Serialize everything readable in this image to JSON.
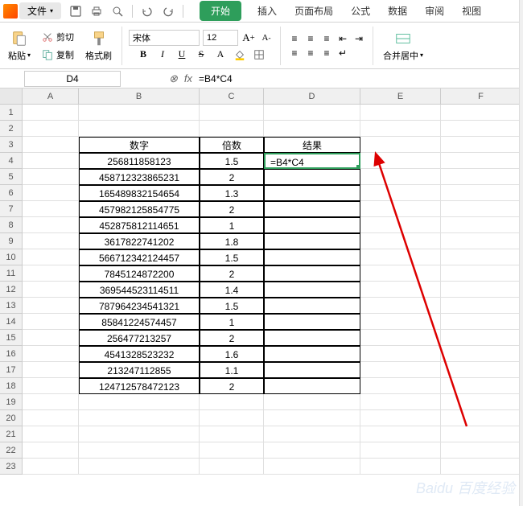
{
  "menubar": {
    "file_label": "文件",
    "tabs": [
      "开始",
      "插入",
      "页面布局",
      "公式",
      "数据",
      "审阅",
      "视图"
    ],
    "active_tab_index": 0
  },
  "ribbon": {
    "paste_label": "粘贴",
    "cut_label": "剪切",
    "copy_label": "复制",
    "format_painter_label": "格式刷",
    "font_name": "宋体",
    "font_size": "12",
    "merge_label": "合并居中"
  },
  "formula_bar": {
    "cell_ref": "D4",
    "formula": "=B4*C4"
  },
  "columns": [
    "A",
    "B",
    "C",
    "D",
    "E",
    "F"
  ],
  "row_numbers": [
    1,
    2,
    3,
    4,
    5,
    6,
    7,
    8,
    9,
    10,
    11,
    12,
    13,
    14,
    15,
    16,
    17,
    18,
    19,
    20,
    21,
    22,
    23
  ],
  "table_header": {
    "b": "数字",
    "c": "倍数",
    "d": "结果"
  },
  "data_rows": [
    {
      "b": "256811858123",
      "c": "1.5"
    },
    {
      "b": "458712323865231",
      "c": "2"
    },
    {
      "b": "165489832154654",
      "c": "1.3"
    },
    {
      "b": "457982125854775",
      "c": "2"
    },
    {
      "b": "452875812114651",
      "c": "1"
    },
    {
      "b": "3617822741202",
      "c": "1.8"
    },
    {
      "b": "566712342124457",
      "c": "1.5"
    },
    {
      "b": "7845124872200",
      "c": "2"
    },
    {
      "b": "369544523114511",
      "c": "1.4"
    },
    {
      "b": "787964234541321",
      "c": "1.5"
    },
    {
      "b": "85841224574457",
      "c": "1"
    },
    {
      "b": "256477213257",
      "c": "2"
    },
    {
      "b": "4541328523232",
      "c": "1.6"
    },
    {
      "b": "213247112855",
      "c": "1.1"
    },
    {
      "b": "124712578472123",
      "c": "2"
    }
  ],
  "active_cell_display": "=B4*C4",
  "watermark": "Baidu 百度经验"
}
